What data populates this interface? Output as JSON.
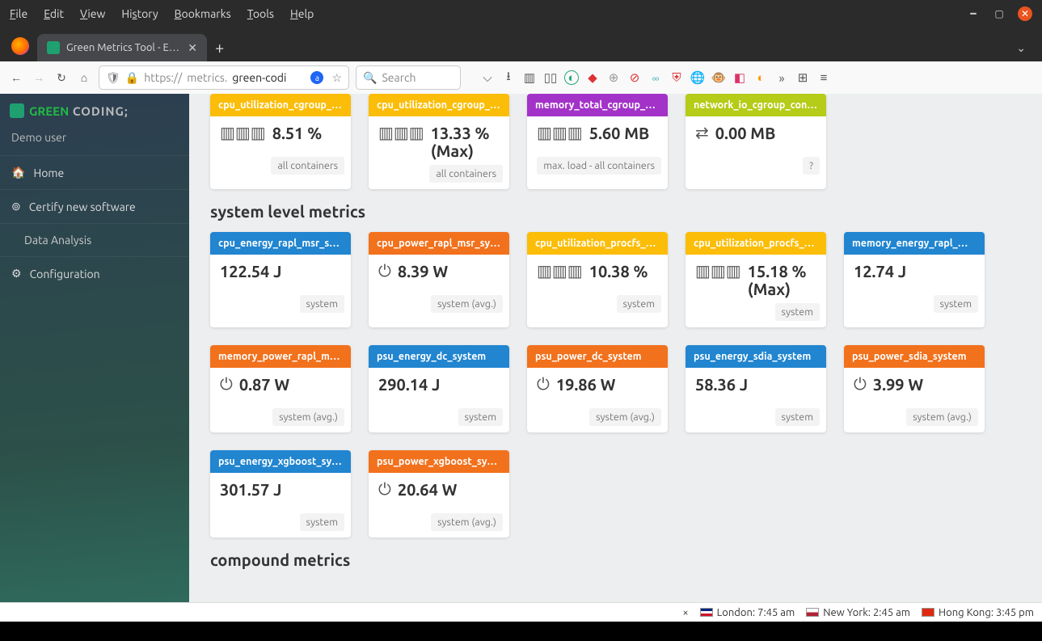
{
  "menubar": [
    "File",
    "Edit",
    "View",
    "History",
    "Bookmarks",
    "Tools",
    "Help"
  ],
  "tab": {
    "title": "Green Metrics Tool - Expe"
  },
  "url": {
    "scheme": "https://",
    "host_pre": "metrics.",
    "host_bold": "green-codi"
  },
  "search": {
    "placeholder": "Search"
  },
  "sidebar": {
    "brand_green": "GREEN",
    "brand_coding": " CODING;",
    "user": "Demo user",
    "items": [
      {
        "icon": "home",
        "label": "Home"
      },
      {
        "icon": "target",
        "label": "Certify new software"
      },
      {
        "icon": "",
        "label": "Data Analysis",
        "sub": true
      },
      {
        "icon": "cogs",
        "label": "Configuration"
      }
    ]
  },
  "sections": {
    "row1": [
      {
        "color": "yellow",
        "title": "cpu_utilization_cgroup_co...",
        "icon": "memory",
        "value": "8.51 %",
        "footer": "all containers"
      },
      {
        "color": "yellow",
        "title": "cpu_utilization_cgroup_co...",
        "icon": "memory",
        "value": "13.33 % (Max)",
        "footer": "all containers"
      },
      {
        "color": "purple",
        "title": "memory_total_cgroup_co...",
        "icon": "memory",
        "value": "5.60 MB",
        "footer": "max. load - all containers"
      },
      {
        "color": "olive",
        "title": "network_io_cgroup_conta...",
        "icon": "exchange",
        "value": "0.00 MB",
        "footer": "?"
      }
    ],
    "system_title": "system level metrics",
    "system": [
      {
        "color": "blue",
        "title": "cpu_energy_rapl_msr_syst...",
        "icon": "",
        "value": "122.54 J",
        "footer": "system"
      },
      {
        "color": "orange",
        "title": "cpu_power_rapl_msr_syst...",
        "icon": "power",
        "value": "8.39 W",
        "footer": "system (avg.)"
      },
      {
        "color": "yellow",
        "title": "cpu_utilization_procfs_sys...",
        "icon": "memory",
        "value": "10.38 %",
        "footer": "system"
      },
      {
        "color": "yellow",
        "title": "cpu_utilization_procfs_sys...",
        "icon": "memory",
        "value": "15.18 % (Max)",
        "footer": "system"
      },
      {
        "color": "blue",
        "title": "memory_energy_rapl_msr...",
        "icon": "",
        "value": "12.74 J",
        "footer": "system"
      },
      {
        "color": "orange",
        "title": "memory_power_rapl_msr_...",
        "icon": "power",
        "value": "0.87 W",
        "footer": "system (avg.)"
      },
      {
        "color": "blue",
        "title": "psu_energy_dc_system",
        "icon": "",
        "value": "290.14 J",
        "footer": "system"
      },
      {
        "color": "orange",
        "title": "psu_power_dc_system",
        "icon": "power",
        "value": "19.86 W",
        "footer": "system (avg.)"
      },
      {
        "color": "blue",
        "title": "psu_energy_sdia_system",
        "icon": "",
        "value": "58.36 J",
        "footer": "system"
      },
      {
        "color": "orange",
        "title": "psu_power_sdia_system",
        "icon": "power",
        "value": "3.99 W",
        "footer": "system (avg.)"
      },
      {
        "color": "blue",
        "title": "psu_energy_xgboost_syst...",
        "icon": "",
        "value": "301.57 J",
        "footer": "system"
      },
      {
        "color": "orange",
        "title": "psu_power_xgboost_system",
        "icon": "power",
        "value": "20.64 W",
        "footer": "system (avg.)"
      }
    ],
    "compound_title": "compound metrics"
  },
  "status": {
    "close_x": "×",
    "cities": [
      {
        "flag": "uk",
        "text": "London: 7:45 am"
      },
      {
        "flag": "us",
        "text": "New York: 2:45 am"
      },
      {
        "flag": "hk",
        "text": "Hong Kong: 3:45 pm"
      }
    ]
  }
}
